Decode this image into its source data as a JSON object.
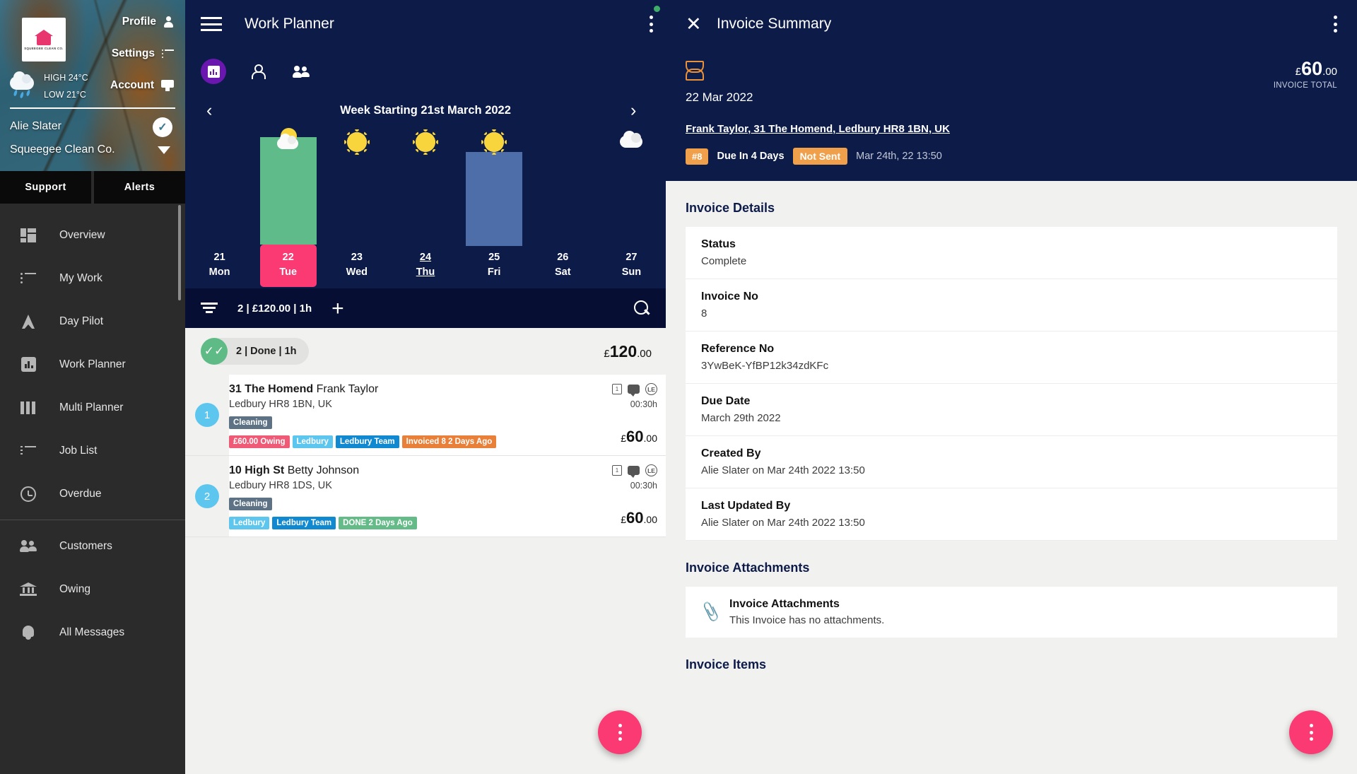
{
  "sidebar": {
    "logo_text": "SQUEEGEE CLEAN CO.",
    "weather": {
      "high": "HIGH 24°C",
      "low": "LOW 21°C"
    },
    "links": [
      {
        "label": "Profile",
        "icon": "person-icon"
      },
      {
        "label": "Settings",
        "icon": "list-icon"
      },
      {
        "label": "Account",
        "icon": "card-icon"
      }
    ],
    "account_name": "Alie Slater",
    "company_name": "Squeegee Clean Co.",
    "buttons": [
      "Support",
      "Alerts"
    ],
    "nav": [
      {
        "label": "Overview",
        "icon": "grid-icon"
      },
      {
        "label": "My Work",
        "icon": "bulleted-list-icon"
      },
      {
        "label": "Day Pilot",
        "icon": "navigation-arrow-icon"
      },
      {
        "label": "Work Planner",
        "icon": "bar-chart-icon"
      },
      {
        "label": "Multi Planner",
        "icon": "columns-icon"
      },
      {
        "label": "Job List",
        "icon": "job-list-icon"
      },
      {
        "label": "Overdue",
        "icon": "clock-icon"
      }
    ],
    "nav2": [
      {
        "label": "Customers",
        "icon": "people-icon"
      },
      {
        "label": "Owing",
        "icon": "bank-icon"
      },
      {
        "label": "All Messages",
        "icon": "bell-icon"
      }
    ]
  },
  "center": {
    "title": "Work Planner",
    "tabs": [
      {
        "name": "chart-view",
        "selected": true
      },
      {
        "name": "person-view",
        "selected": false
      },
      {
        "name": "team-view",
        "selected": false
      }
    ],
    "week_title": "Week Starting 21st March 2022",
    "prev_arrow": "‹",
    "next_arrow": "›",
    "filter_summary": "2 | £120.00 | 1h",
    "plus": "+",
    "group": {
      "label": "2 | Done | 1h",
      "check": "✓✓",
      "currency": "£",
      "amount": "120",
      "cents": ".00"
    },
    "jobs": [
      {
        "num": "1",
        "address_bold": "31 The Homend",
        "customer": "Frank Taylor",
        "location": "Ledbury HR8 1BN, UK",
        "category": "Cleaning",
        "tags": [
          {
            "text": "£60.00 Owing",
            "color": "#ef5b77"
          },
          {
            "text": "Ledbury",
            "color": "#5cc6ef"
          },
          {
            "text": "Ledbury Team",
            "color": "#1089d0"
          },
          {
            "text": "Invoiced 8 2 Days Ago",
            "color": "#e8803a"
          }
        ],
        "note_icon": "1",
        "avatar_initials": "LE",
        "duration": "00:30h",
        "currency": "£",
        "amount": "60",
        "cents": ".00"
      },
      {
        "num": "2",
        "address_bold": "10 High St",
        "customer": "Betty Johnson",
        "location": "Ledbury HR8 1DS, UK",
        "category": "Cleaning",
        "tags": [
          {
            "text": "Ledbury",
            "color": "#5cc6ef"
          },
          {
            "text": "Ledbury Team",
            "color": "#1089d0"
          },
          {
            "text": "DONE 2 Days Ago",
            "color": "#64bb88"
          }
        ],
        "note_icon": "1",
        "avatar_initials": "LE",
        "duration": "00:30h",
        "currency": "£",
        "amount": "60",
        "cents": ".00"
      }
    ]
  },
  "chart_data": {
    "type": "bar",
    "title": "Week Starting 21st March 2022",
    "categories": [
      "21 Mon",
      "22 Tue",
      "23 Wed",
      "24 Thu",
      "25 Fri",
      "26 Sat",
      "27 Sun"
    ],
    "day_numbers": [
      "21",
      "22",
      "23",
      "24",
      "25",
      "26",
      "27"
    ],
    "day_names": [
      "Mon",
      "Tue",
      "Wed",
      "Thu",
      "Fri",
      "Sat",
      "Sun"
    ],
    "values": [
      0,
      120,
      0,
      0,
      105,
      0,
      0
    ],
    "bar_colors": [
      "",
      "#60bb8b",
      "",
      "",
      "#4d6ea8",
      "",
      ""
    ],
    "selected_index": 1,
    "today_index": 3,
    "weather_icons": [
      "",
      "partly-sunny",
      "sunny",
      "sunny",
      "sunny",
      "",
      "cloudy"
    ],
    "ylim": [
      0,
      130
    ],
    "xlabel": "",
    "ylabel": "",
    "grid": false
  },
  "right": {
    "title": "Invoice Summary",
    "close": "✕",
    "status_icon": "hourglass-icon",
    "total": {
      "currency": "£",
      "amount": "60",
      "cents": ".00",
      "label": "INVOICE TOTAL"
    },
    "date": "22 Mar 2022",
    "address": "Frank Taylor, 31 The Homend, Ledbury HR8 1BN, UK",
    "meta": {
      "number": "#8",
      "due": "Due In 4 Days",
      "sent_status": "Not Sent",
      "timestamp": "Mar 24th, 22 13:50"
    },
    "details_title": "Invoice Details",
    "details": [
      {
        "key": "Status",
        "value": "Complete"
      },
      {
        "key": "Invoice No",
        "value": "8"
      },
      {
        "key": "Reference No",
        "value": "3YwBeK-YfBP12k34zdKFc"
      },
      {
        "key": "Due Date",
        "value": "March 29th 2022"
      },
      {
        "key": "Created By",
        "value": "Alie Slater on Mar 24th 2022 13:50"
      },
      {
        "key": "Last Updated By",
        "value": "Alie Slater on Mar 24th 2022 13:50"
      }
    ],
    "attachments_title": "Invoice Attachments",
    "attachment": {
      "key": "Invoice Attachments",
      "value": "This Invoice has no attachments."
    },
    "items_title": "Invoice Items"
  }
}
